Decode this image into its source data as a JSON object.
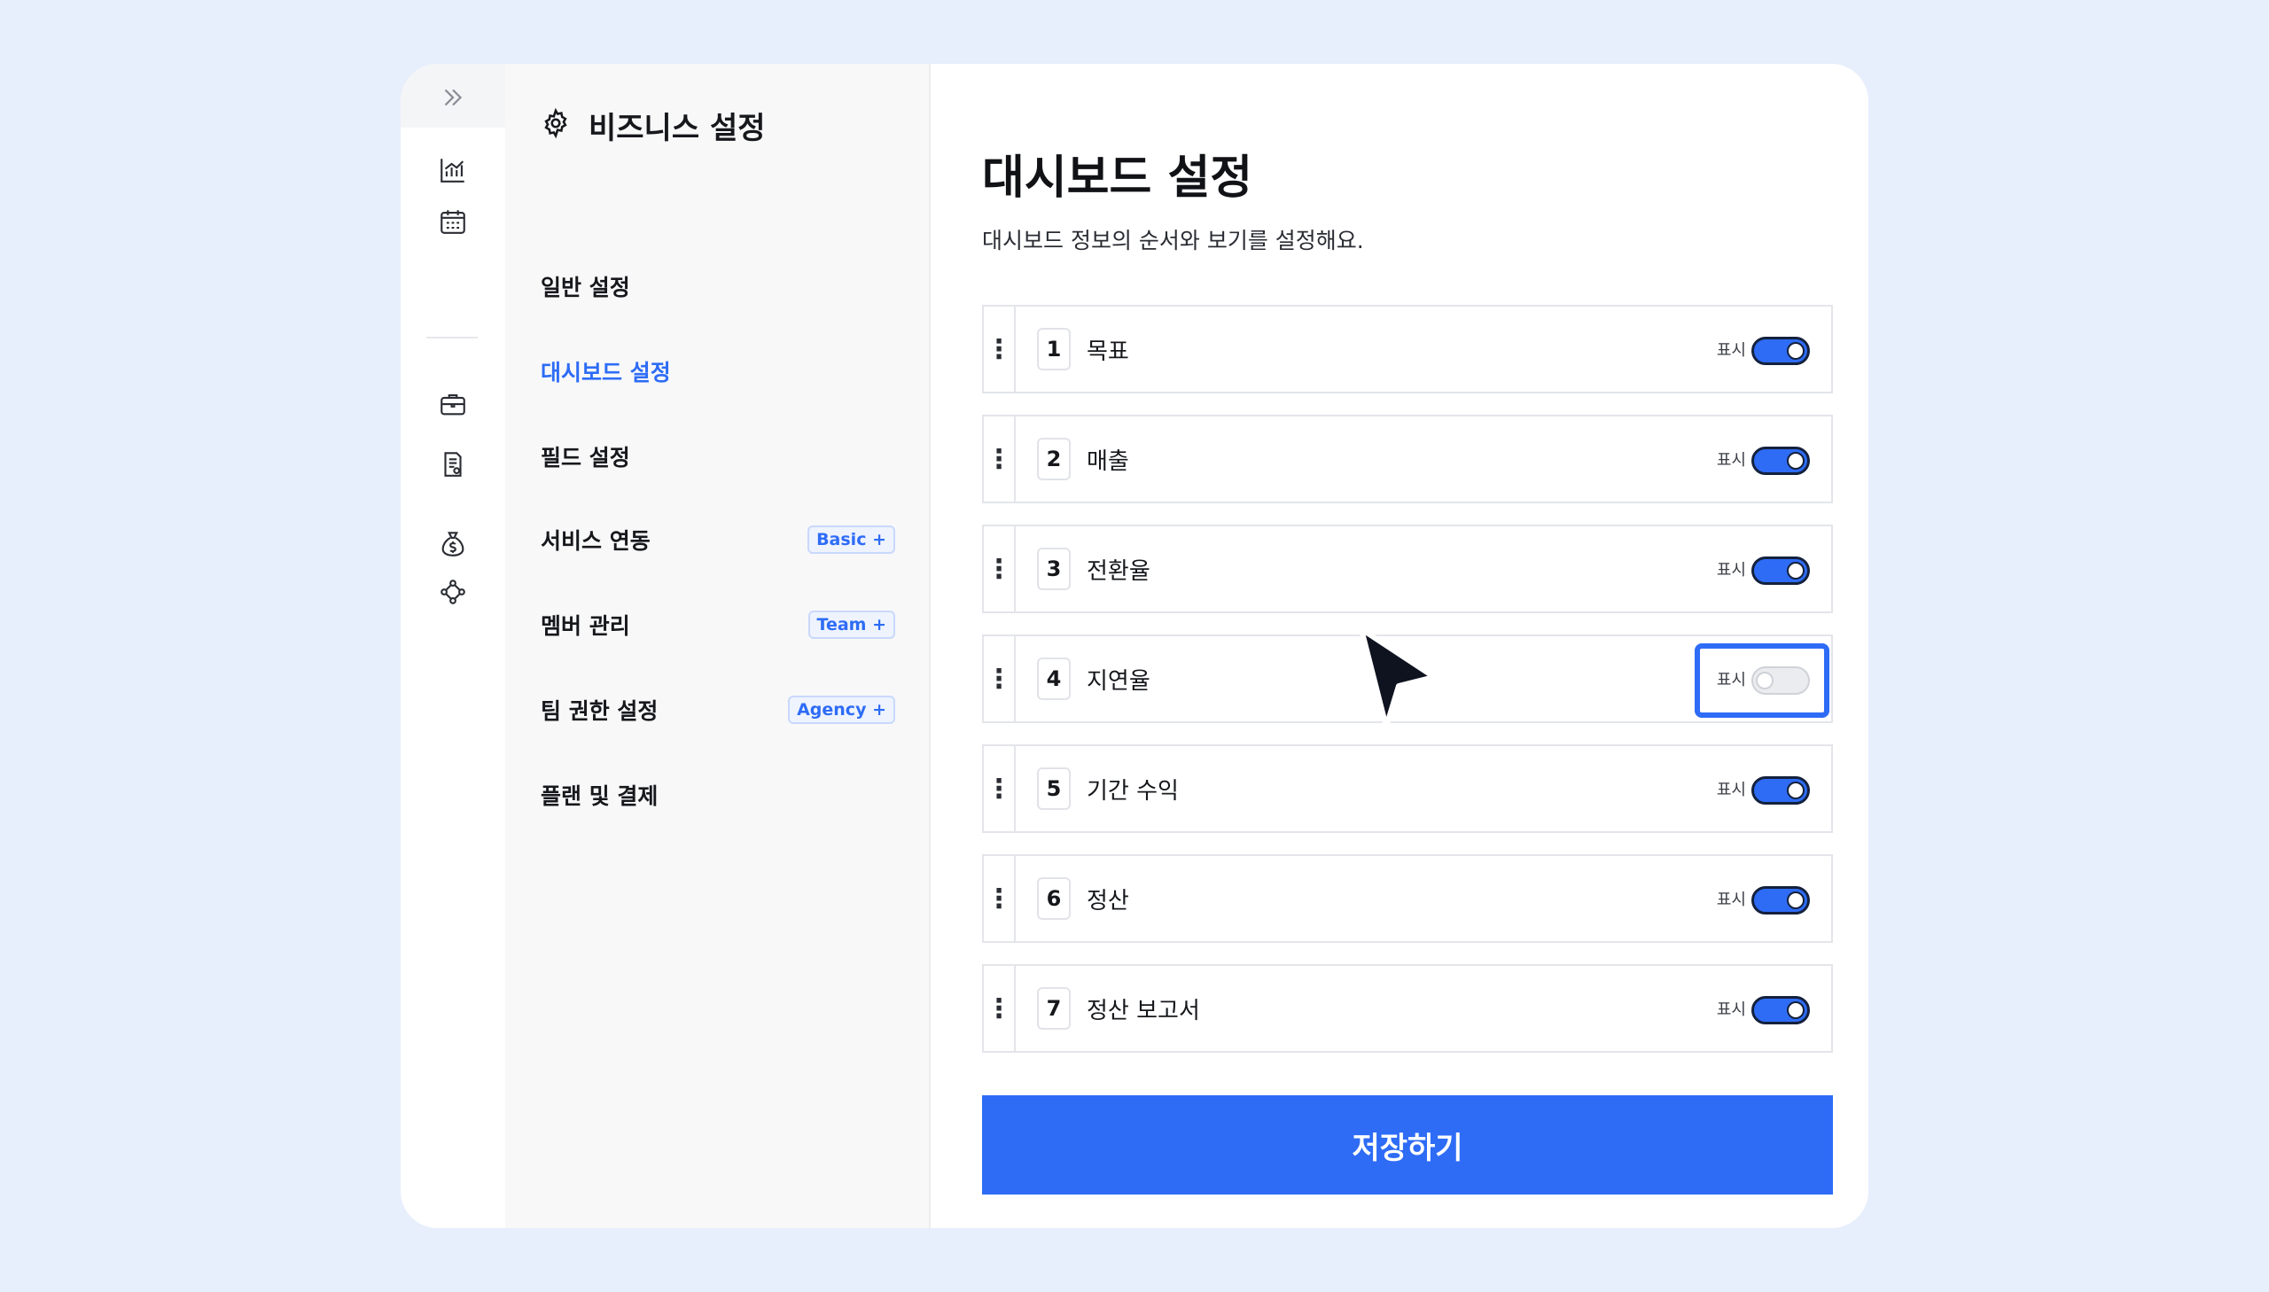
{
  "rail": {
    "icons": [
      "expand-chevrons-icon",
      "chart-icon",
      "calendar-icon",
      "briefcase-icon",
      "document-icon",
      "money-bag-icon",
      "network-icon"
    ]
  },
  "nav": {
    "title": "비즈니스 설정",
    "items": [
      {
        "label": "일반 설정",
        "badge": "",
        "active": false
      },
      {
        "label": "대시보드 설정",
        "badge": "",
        "active": true
      },
      {
        "label": "필드 설정",
        "badge": "",
        "active": false
      },
      {
        "label": "서비스 연동",
        "badge": "Basic +",
        "active": false
      },
      {
        "label": "멤버 관리",
        "badge": "Team +",
        "active": false
      },
      {
        "label": "팀 권한 설정",
        "badge": "Agency +",
        "active": false
      },
      {
        "label": "플랜 및 결제",
        "badge": "",
        "active": false
      }
    ]
  },
  "main": {
    "title": "대시보드 설정",
    "description": "대시보드 정보의 순서와 보기를 설정해요.",
    "rows": [
      {
        "index": "1",
        "label": "목표",
        "show_label": "표시",
        "enabled": true
      },
      {
        "index": "2",
        "label": "매출",
        "show_label": "표시",
        "enabled": true
      },
      {
        "index": "3",
        "label": "전환율",
        "show_label": "표시",
        "enabled": true
      },
      {
        "index": "4",
        "label": "지연율",
        "show_label": "표시",
        "enabled": false
      },
      {
        "index": "5",
        "label": "기간 수익",
        "show_label": "표시",
        "enabled": true
      },
      {
        "index": "6",
        "label": "정산",
        "show_label": "표시",
        "enabled": true
      },
      {
        "index": "7",
        "label": "정산 보고서",
        "show_label": "표시",
        "enabled": true
      }
    ],
    "save_label": "저장하기"
  },
  "colors": {
    "accent": "#2e6cf6",
    "background": "#e7eefc",
    "nav_background": "#f8f8f9"
  }
}
